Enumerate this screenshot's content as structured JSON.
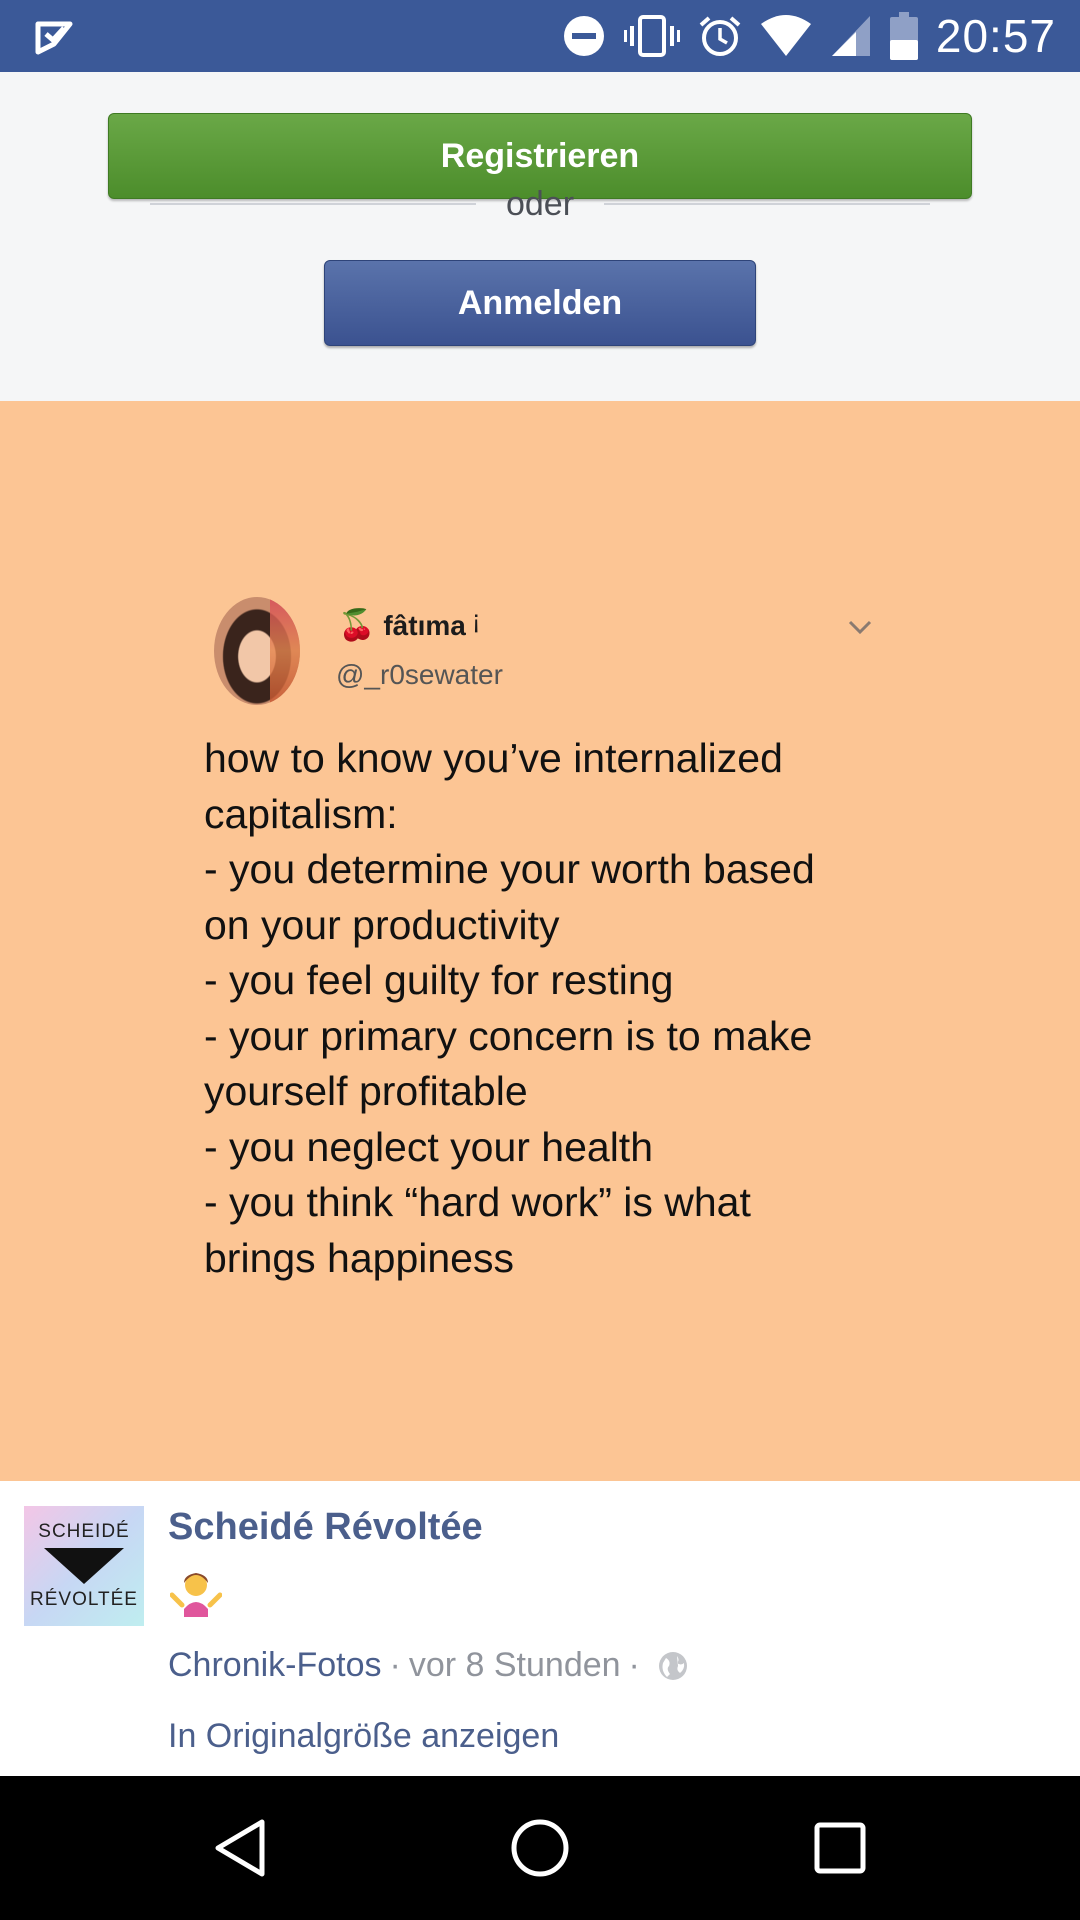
{
  "status_bar": {
    "time": "20:57",
    "icons": [
      "app-notification-icon",
      "do-not-disturb-icon",
      "vibrate-icon",
      "alarm-icon",
      "wifi-icon",
      "signal-icon",
      "battery-icon"
    ],
    "background_color": "#3b5998"
  },
  "auth": {
    "register_label": "Registrieren",
    "or_label": "oder",
    "login_label": "Anmelden",
    "register_color": "#5a9a39",
    "login_color": "#4b62a0"
  },
  "post_image": {
    "background_color": "#fcc594",
    "tweet": {
      "display_name": "fâtıma",
      "name_mark": "¡",
      "handle": "@_r0sewater",
      "lines": [
        "how to know you’ve internalized",
        "capitalism:",
        "- you determine your worth based",
        "on your productivity",
        "- you feel guilty for resting",
        "- your primary concern is to make",
        "yourself profitable",
        "- you neglect your health",
        "- you think “hard work” is what",
        "brings happiness"
      ]
    }
  },
  "post_info": {
    "logo_top": "SCHEIDÉ",
    "logo_bottom": "RÉVOLTÉE",
    "page_name": "Scheidé Révoltée",
    "emoji": "person-shrugging-emoji",
    "album_link": "Chronik-Fotos",
    "separator": "·",
    "time_ago": "vor 8 Stunden",
    "privacy_icon": "globe-icon",
    "full_size_link": "In Originalgröße anzeigen",
    "link_color": "#4b5f8c"
  },
  "nav_bar": {
    "buttons": [
      "back-icon",
      "home-icon",
      "recents-icon"
    ]
  }
}
